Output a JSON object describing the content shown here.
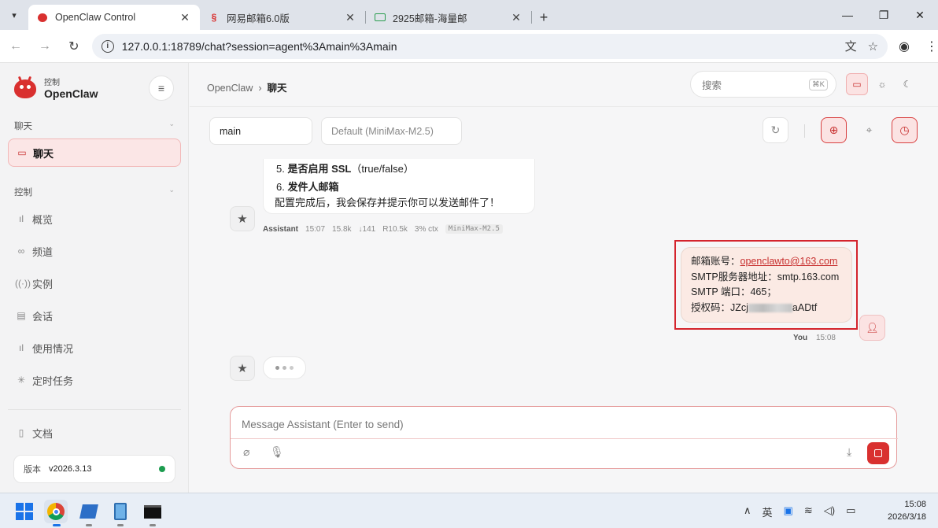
{
  "browser": {
    "tabs": [
      {
        "title": "OpenClaw Control",
        "active": true
      },
      {
        "title": "网易邮箱6.0版",
        "active": false
      },
      {
        "title": "2925邮箱-海量邮",
        "active": false
      }
    ],
    "url": "127.0.0.1:18789/chat?session=agent%3Amain%3Amain"
  },
  "sidebar": {
    "brand_sub": "控制",
    "brand_name": "OpenClaw",
    "section_chat": "聊天",
    "chat_item": "聊天",
    "section_control": "控制",
    "items": [
      {
        "label": "概览",
        "icon": "bar-chart-icon"
      },
      {
        "label": "频道",
        "icon": "link-icon"
      },
      {
        "label": "实例",
        "icon": "broadcast-icon"
      },
      {
        "label": "会话",
        "icon": "document-icon"
      },
      {
        "label": "使用情况",
        "icon": "bar-chart-icon"
      },
      {
        "label": "定时任务",
        "icon": "loader-icon"
      }
    ],
    "docs": "文档",
    "version_label": "版本",
    "version_value": "v2026.3.13",
    "status_color": "#1c9c4f"
  },
  "header": {
    "breadcrumb_root": "OpenClaw",
    "breadcrumb_sep": "›",
    "breadcrumb_current": "聊天",
    "search_placeholder": "搜索",
    "search_shortcut": "⌘K"
  },
  "controls": {
    "session": "main",
    "model": "Default (MiniMax-M2.5)"
  },
  "messages": {
    "assistant_lines": [
      {
        "num": "5.",
        "bold": "是否启用 SSL",
        "rest": "（true/false）"
      },
      {
        "num": "6.",
        "bold": "发件人邮箱",
        "rest": ""
      }
    ],
    "assistant_tail": "配置完成后，我会保存并提示你可以发送邮件了！",
    "assistant_meta": {
      "role": "Assistant",
      "time": "15:07",
      "input": "15.8k",
      "output": "↓141",
      "read": "R10.5k",
      "ctx": "3% ctx",
      "model": "MiniMax-M2.5"
    },
    "user": {
      "line1_label": "邮箱账号：",
      "line1_value": "openclawto@163.com",
      "line2": "SMTP服务器地址：smtp.163.com",
      "line3": "SMTP 端口：465；",
      "line4_label": "授权码：JZcj",
      "line4_tail": "aADtf"
    },
    "user_meta": {
      "role": "You",
      "time": "15:08"
    }
  },
  "composer": {
    "placeholder": "Message Assistant (Enter to send)"
  },
  "taskbar": {
    "clock_time": "15:08",
    "clock_date": "2026/3/18",
    "ime": "英"
  },
  "colors": {
    "accent": "#d9302f",
    "user_bubble": "#fbeae4",
    "highlight_box": "#d4242d"
  }
}
